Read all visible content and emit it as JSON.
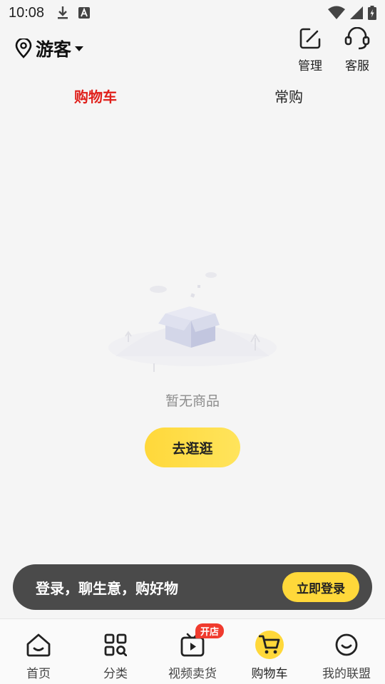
{
  "status_bar": {
    "time": "10:08"
  },
  "header": {
    "location": "游客",
    "manage_label": "管理",
    "service_label": "客服"
  },
  "tabs": [
    {
      "label": "购物车",
      "active": true
    },
    {
      "label": "常购",
      "active": false
    }
  ],
  "empty_state": {
    "message": "暂无商品",
    "button_label": "去逛逛"
  },
  "login_banner": {
    "text": "登录，聊生意，购好物",
    "button_label": "立即登录"
  },
  "bottom_nav": {
    "items": [
      {
        "label": "首页",
        "icon": "home-icon"
      },
      {
        "label": "分类",
        "icon": "category-icon"
      },
      {
        "label": "视频卖货",
        "icon": "video-icon",
        "badge": "开店"
      },
      {
        "label": "购物车",
        "icon": "cart-icon",
        "active": true
      },
      {
        "label": "我的联盟",
        "icon": "smile-icon"
      }
    ]
  },
  "colors": {
    "accent": "#ffd83a",
    "active_tab": "#e0201b",
    "banner_bg": "#4a4a4a",
    "badge": "#f03b2e"
  }
}
